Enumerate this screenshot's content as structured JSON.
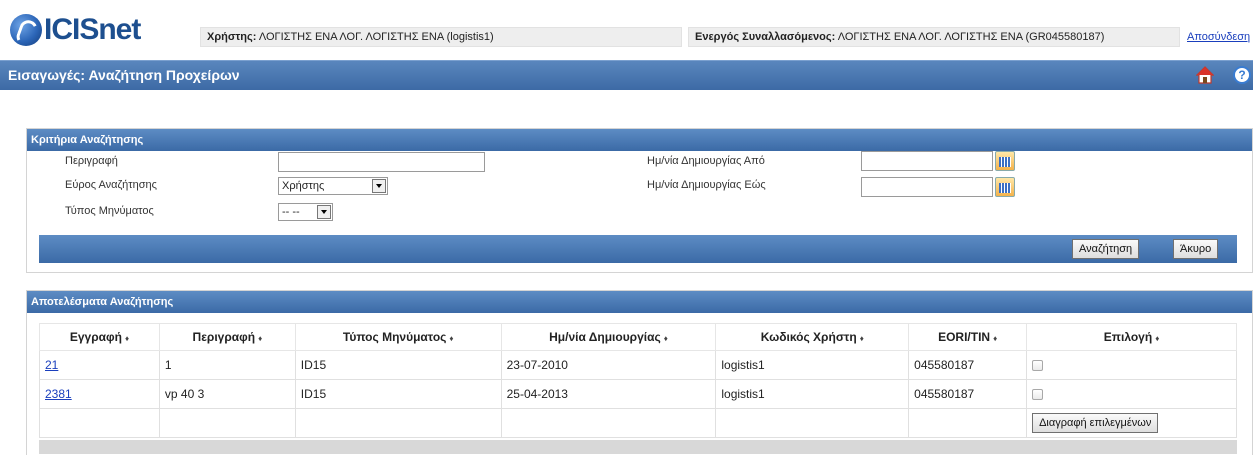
{
  "header": {
    "logo_text": "ICISnet",
    "user_label": "Χρήστης:",
    "user_value": "ΛΟΓΙΣΤΗΣ ΕΝΑ ΛΟΓ. ΛΟΓΙΣΤΗΣ ΕΝΑ (logistis1)",
    "trader_label": "Ενεργός Συναλλασόμενος:",
    "trader_value": "ΛΟΓΙΣΤΗΣ ΕΝΑ ΛΟΓ. ΛΟΓΙΣΤΗΣ ΕΝΑ (GR045580187)",
    "logout_text": "Αποσύνδεση"
  },
  "titlebar": {
    "title": "Εισαγωγές: Αναζήτηση Προχείρων",
    "help_symbol": "?"
  },
  "criteria": {
    "heading": "Κριτήρια Αναζήτησης",
    "description_label": "Περιγραφή",
    "description_value": "",
    "scope_label": "Εύρος Αναζήτησης",
    "scope_value": "Χρήστης",
    "message_type_label": "Τύπος Μηνύματος",
    "message_type_value": "-- --",
    "date_from_label": "Ημ/νία Δημιουργίας Από",
    "date_from_value": "",
    "date_to_label": "Ημ/νία Δημιουργίας Εώς",
    "date_to_value": "",
    "search_button": "Αναζήτηση",
    "cancel_button": "Άκυρο"
  },
  "results": {
    "heading": "Αποτελέσματα Αναζήτησης",
    "sort_symbol": "♦",
    "columns": [
      "Εγγραφή",
      "Περιγραφή",
      "Τύπος Μηνύματος",
      "Ημ/νία Δημιουργίας",
      "Κωδικός Χρήστη",
      "EORI/TIN",
      "Επιλογή"
    ],
    "rows": [
      {
        "id": "21",
        "description": "1",
        "message_type": "ID15",
        "created": "23-07-2010",
        "user_code": "logistis1",
        "eori": "045580187",
        "selected": false
      },
      {
        "id": "2381",
        "description": "vp 40 3",
        "message_type": "ID15",
        "created": "25-04-2013",
        "user_code": "logistis1",
        "eori": "045580187",
        "selected": false
      }
    ],
    "delete_selected_button": "Διαγραφή επιλεγμένων"
  }
}
